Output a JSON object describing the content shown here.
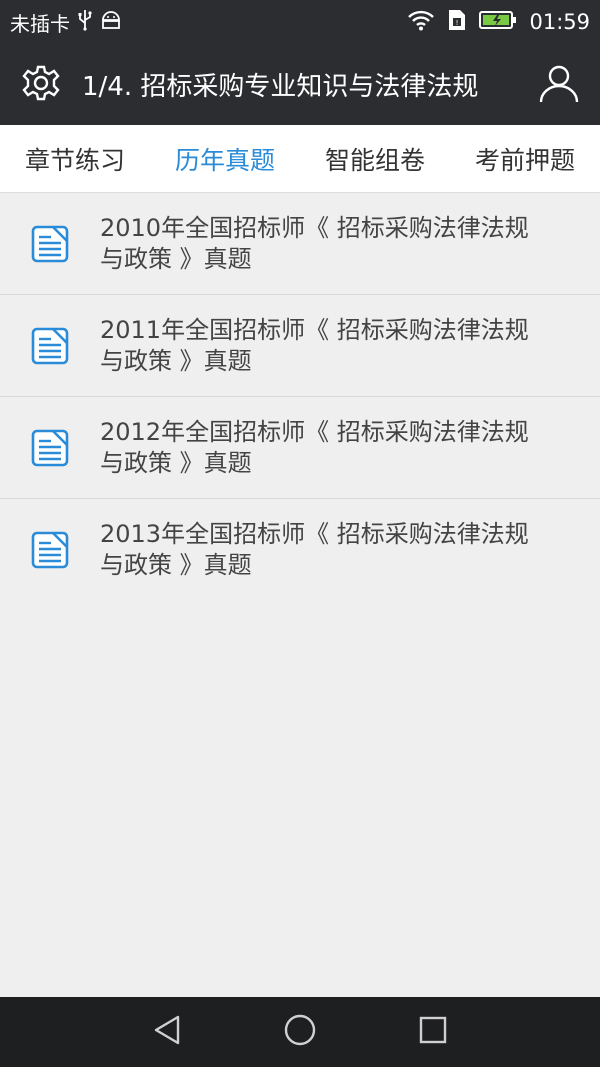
{
  "status_bar": {
    "carrier": "未插卡",
    "time": "01:59",
    "icons": [
      "usb-icon",
      "android-debug-icon",
      "wifi-icon",
      "sim-icon",
      "battery-charging-icon"
    ]
  },
  "app_bar": {
    "title": "1/4. 招标采购专业知识与法律法规",
    "left_icon": "gear-icon",
    "right_icon": "user-icon"
  },
  "tabs": [
    {
      "label": "章节练习",
      "active": false
    },
    {
      "label": "历年真题",
      "active": true
    },
    {
      "label": "智能组卷",
      "active": false
    },
    {
      "label": "考前押题",
      "active": false
    }
  ],
  "list": [
    {
      "line1": "2010年全国招标师《 招标采购法律法规",
      "line2": "与政策 》真题",
      "icon": "document-icon"
    },
    {
      "line1": "2011年全国招标师《 招标采购法律法规",
      "line2": "与政策 》真题",
      "icon": "document-icon"
    },
    {
      "line1": "2012年全国招标师《 招标采购法律法规",
      "line2": "与政策 》真题",
      "icon": "document-icon"
    },
    {
      "line1": "2013年全国招标师《 招标采购法律法规",
      "line2": "与政策 》真题",
      "icon": "document-icon"
    }
  ],
  "nav_bar": {
    "icons": [
      "back-icon",
      "home-icon",
      "recents-icon"
    ]
  },
  "colors": {
    "bar_bg": "#2b2d30",
    "accent": "#2a8bd8",
    "list_bg": "#efefef",
    "nav_bg": "#1e1f21"
  }
}
